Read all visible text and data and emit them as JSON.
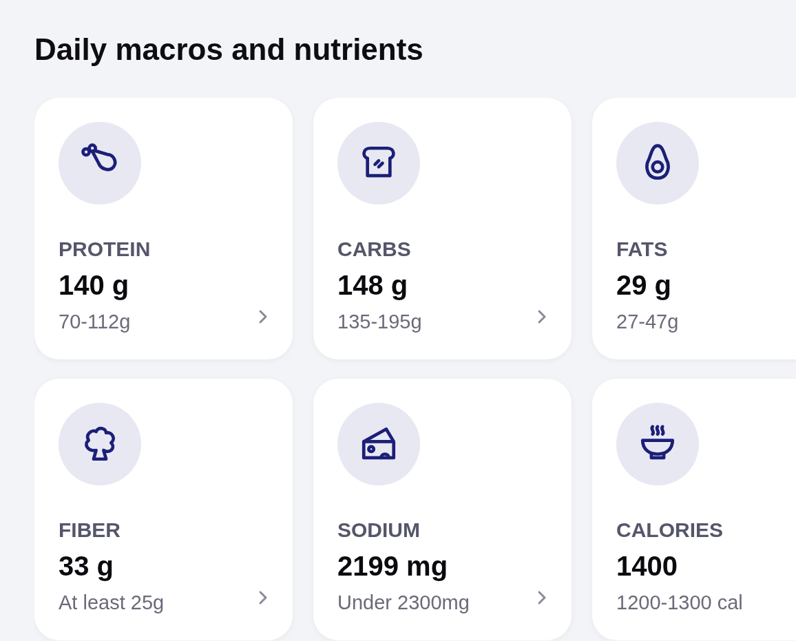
{
  "title": "Daily macros and nutrients",
  "cards": [
    {
      "kind": "drumstick",
      "label": "PROTEIN",
      "value": "140 g",
      "range": "70-112g"
    },
    {
      "kind": "bread",
      "label": "CARBS",
      "value": "148 g",
      "range": "135-195g"
    },
    {
      "kind": "avocado",
      "label": "FATS",
      "value": "29 g",
      "range": "27-47g"
    },
    {
      "kind": "broccoli",
      "label": "FIBER",
      "value": "33 g",
      "range": "At least 25g"
    },
    {
      "kind": "cheese",
      "label": "SODIUM",
      "value": "2199 mg",
      "range": "Under 2300mg"
    },
    {
      "kind": "bowl",
      "label": "CALORIES",
      "value": "1400",
      "range": "1200-1300 cal"
    }
  ]
}
